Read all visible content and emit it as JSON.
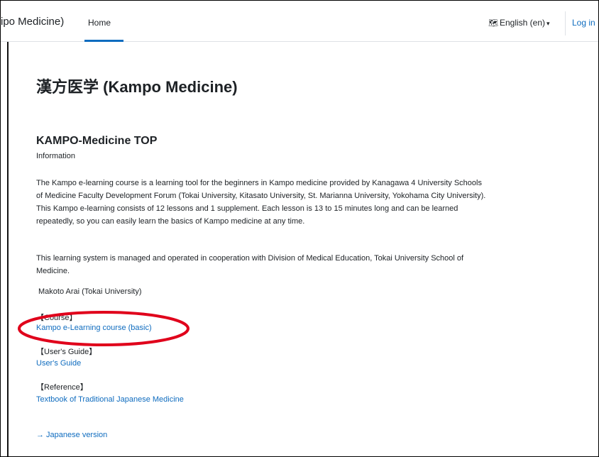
{
  "navbar": {
    "brand": "ipo Medicine)",
    "home": "Home",
    "language": "English (en)",
    "login": "Log in"
  },
  "page": {
    "title": "漢方医学 (Kampo Medicine)",
    "section_title": "KAMPO-Medicine TOP",
    "info": "Information",
    "paragraph1": "The Kampo e-learning course is a learning tool for the beginners in Kampo medicine provided by Kanagawa 4 University Schools of Medicine Faculty Development Forum (Tokai University, Kitasato University, St. Marianna University, Yokohama City University). This Kampo e-learning consists of 12 lessons and 1 supplement. Each lesson is 13 to 15 minutes long and can be learned repeatedly, so you can easily learn the basics of Kampo medicine at any time.",
    "paragraph2": "This learning system is managed and operated in cooperation with Division of Medical Education, Tokai University School of Medicine.",
    "author": "Makoto Arai (Tokai University)",
    "course_label": "【Course】",
    "course_link": "Kampo e-Learning course (basic)",
    "guide_label": "【User's Guide】",
    "guide_link": "User's Guide",
    "reference_label": "【Reference】",
    "reference_link": "Textbook of Traditional Japanese Medicine",
    "japanese_link": "→ Japanese version"
  },
  "colors": {
    "link": "#0f6cbf",
    "highlight": "#e0001b"
  }
}
